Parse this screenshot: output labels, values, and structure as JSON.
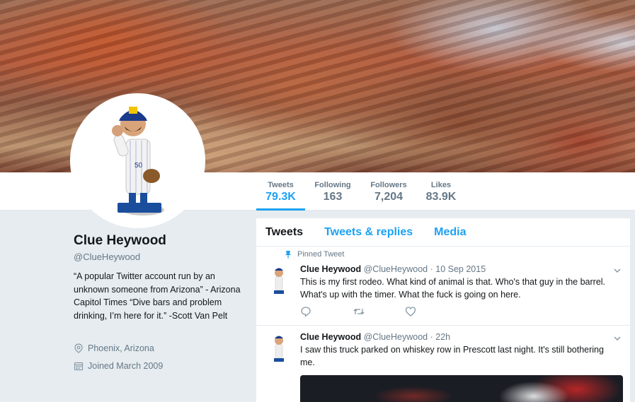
{
  "profile": {
    "name": "Clue Heywood",
    "handle": "@ClueHeywood",
    "bio": "“A popular Twitter account run by an unknown someone from Arizona” - Arizona Capitol Times “Dive bars and problem drinking, I’m here for it.” -Scott Van Pelt",
    "location": "Phoenix, Arizona",
    "joined": "Joined March 2009"
  },
  "stats": [
    {
      "label": "Tweets",
      "value": "79.3K"
    },
    {
      "label": "Following",
      "value": "163"
    },
    {
      "label": "Followers",
      "value": "7,204"
    },
    {
      "label": "Likes",
      "value": "83.9K"
    }
  ],
  "tabs": [
    {
      "label": "Tweets"
    },
    {
      "label": "Tweets & replies"
    },
    {
      "label": "Media"
    }
  ],
  "tweets": [
    {
      "pinned_label": "Pinned Tweet",
      "name": "Clue Heywood",
      "handle": "@ClueHeywood",
      "time": "· 10 Sep 2015",
      "text": "This is my first rodeo. What kind of animal is that. Who's that guy in the barrel. What's up with the timer. What the fuck is going on here."
    },
    {
      "name": "Clue Heywood",
      "handle": "@ClueHeywood",
      "time": "· 22h",
      "text": "I saw this truck parked on whiskey row in Prescott last night. It's still bothering me."
    }
  ],
  "colors": {
    "accent": "#1da1f2",
    "muted": "#657786",
    "background": "#e6ecf0"
  },
  "icons": [
    "pin-icon",
    "chevron-down-icon",
    "reply-icon",
    "retweet-icon",
    "like-icon",
    "location-icon",
    "calendar-icon"
  ]
}
